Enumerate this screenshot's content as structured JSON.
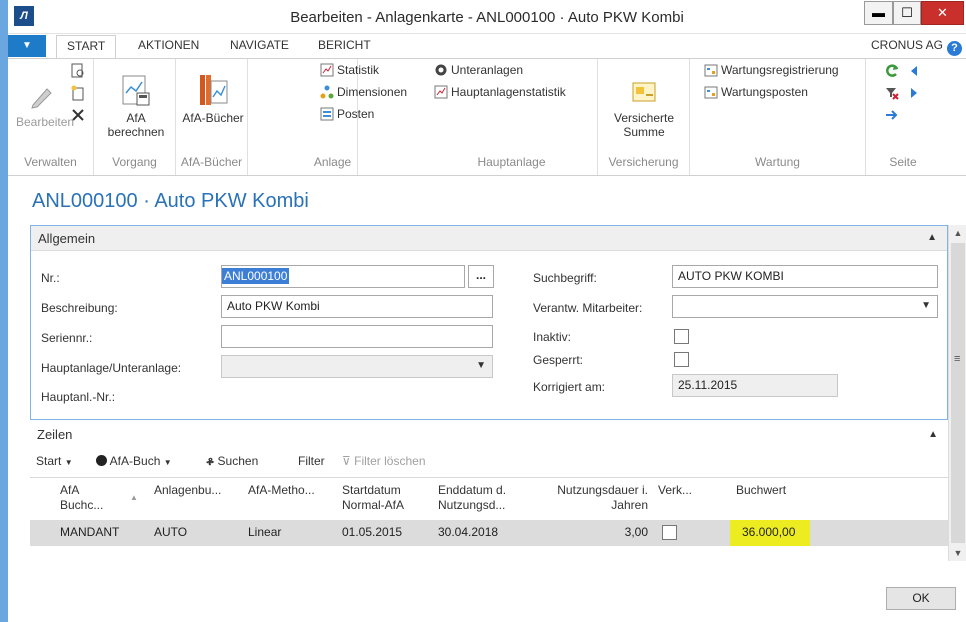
{
  "window": {
    "title": "Bearbeiten - Anlagenkarte - ANL000100 · Auto PKW Kombi",
    "logo_text": "NAV",
    "min_label": "▬",
    "max_label": "☐",
    "close_label": "✕"
  },
  "tabs": {
    "menu_label": "▼",
    "items": [
      "START",
      "AKTIONEN",
      "NAVIGATE",
      "BERICHT"
    ],
    "active": "START",
    "company": "CRONUS AG",
    "help": "?"
  },
  "ribbon": {
    "verwalten": {
      "label": "Verwalten",
      "bearbeiten": "Bearbeiten",
      "icons": [
        "view-icon",
        "new-icon",
        "delete-icon"
      ]
    },
    "vorgang": {
      "label": "Vorgang",
      "afa_berechnen_line1": "AfA",
      "afa_berechnen_line2": "berechnen"
    },
    "afa_buecher": {
      "label": "AfA-Bücher",
      "button": "AfA-Bücher"
    },
    "anlage": {
      "label": "Anlage",
      "statistik": "Statistik",
      "dimensionen": "Dimensionen",
      "posten": "Posten"
    },
    "hauptanlage": {
      "label": "Hauptanlage",
      "unteranlagen": "Unteranlagen",
      "hauptanlagenstatistik": "Hauptanlagenstatistik"
    },
    "versicherung": {
      "label": "Versicherung",
      "line1": "Versicherte",
      "line2": "Summe"
    },
    "wartung": {
      "label": "Wartung",
      "registrierung": "Wartungsregistrierung",
      "posten": "Wartungsposten"
    },
    "seite": {
      "label": "Seite"
    }
  },
  "page_title": "ANL000100 · Auto PKW Kombi",
  "allgemein": {
    "header": "Allgemein",
    "nr_label": "Nr.:",
    "nr_value": "ANL000100",
    "assist": "...",
    "beschreibung_label": "Beschreibung:",
    "beschreibung_value": "Auto PKW Kombi",
    "seriennr_label": "Seriennr.:",
    "seriennr_value": "",
    "hauptunter_label": "Hauptanlage/Unteranlage:",
    "hauptunter_value": "",
    "hauptanl_nr_label": "Hauptanl.-Nr.:",
    "suchbegriff_label": "Suchbegriff:",
    "suchbegriff_value": "AUTO PKW KOMBI",
    "mitarbeiter_label": "Verantw. Mitarbeiter:",
    "mitarbeiter_value": "",
    "inaktiv_label": "Inaktiv:",
    "inaktiv_checked": false,
    "gesperrt_label": "Gesperrt:",
    "gesperrt_checked": false,
    "korrigiert_label": "Korrigiert am:",
    "korrigiert_value": "25.11.2015"
  },
  "zeilen": {
    "header": "Zeilen",
    "toolbar": {
      "start": "Start",
      "afa_buch": "AfA-Buch",
      "suchen": "Suchen",
      "filter": "Filter",
      "filter_loeschen": "Filter löschen"
    },
    "columns": {
      "afa_buch_a": "AfA",
      "afa_buch_b": "Buchc...",
      "anlagenbu": "Anlagenbu...",
      "methode": "AfA-Metho...",
      "startdatum_a": "Startdatum",
      "startdatum_b": "Normal-AfA",
      "enddatum_a": "Enddatum d.",
      "enddatum_b": "Nutzungsd...",
      "nutzung_a": "Nutzungsdauer i.",
      "nutzung_b": "Jahren",
      "verk": "Verk...",
      "buchwert": "Buchwert"
    },
    "rows": [
      {
        "afa_buch": "MANDANT",
        "anlagenbu": "AUTO",
        "methode": "Linear",
        "startdatum": "01.05.2015",
        "enddatum": "30.04.2018",
        "nutzung": "3,00",
        "verkauft": false,
        "buchwert": "36.000,00"
      }
    ]
  },
  "ok_label": "OK",
  "colors": {
    "accent": "#2a72b8",
    "highlight": "#ecec20",
    "close": "#c9302c"
  }
}
